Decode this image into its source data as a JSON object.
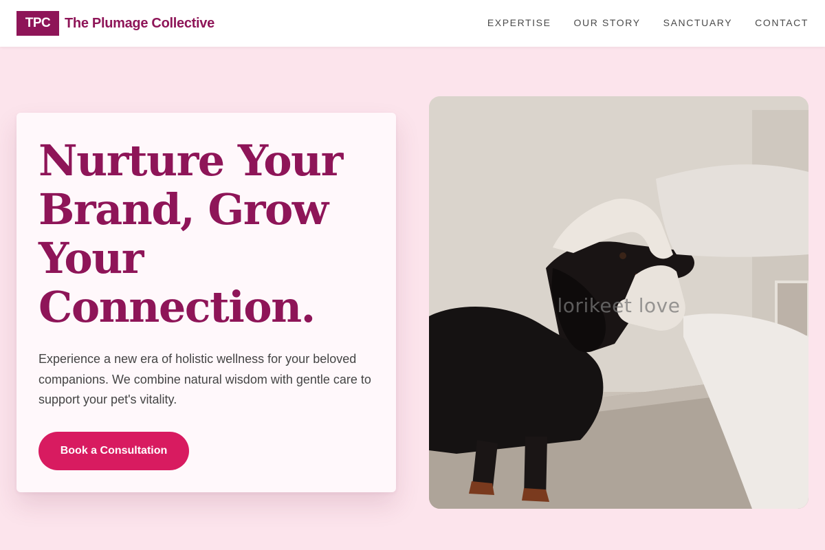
{
  "header": {
    "logo_text": "TPC",
    "brand_name": "The Plumage Collective",
    "nav": [
      "EXPERTISE",
      "OUR STORY",
      "SANCTUARY",
      "CONTACT"
    ]
  },
  "hero": {
    "title": "Nurture Your Brand, Grow Your Connection.",
    "description": "Experience a new era of holistic wellness for your beloved companions. We combine natural wisdom with gentle care to support your pet's vitality.",
    "cta_label": "Book a Consultation"
  },
  "photo": {
    "watermark": "lorikeet love",
    "subject": "veterinarian examining dachshund"
  },
  "colors": {
    "page_bg": "#fce4ec",
    "brand": "#8e1558",
    "accent": "#d81b60",
    "card_bg": "#fff8fb"
  }
}
